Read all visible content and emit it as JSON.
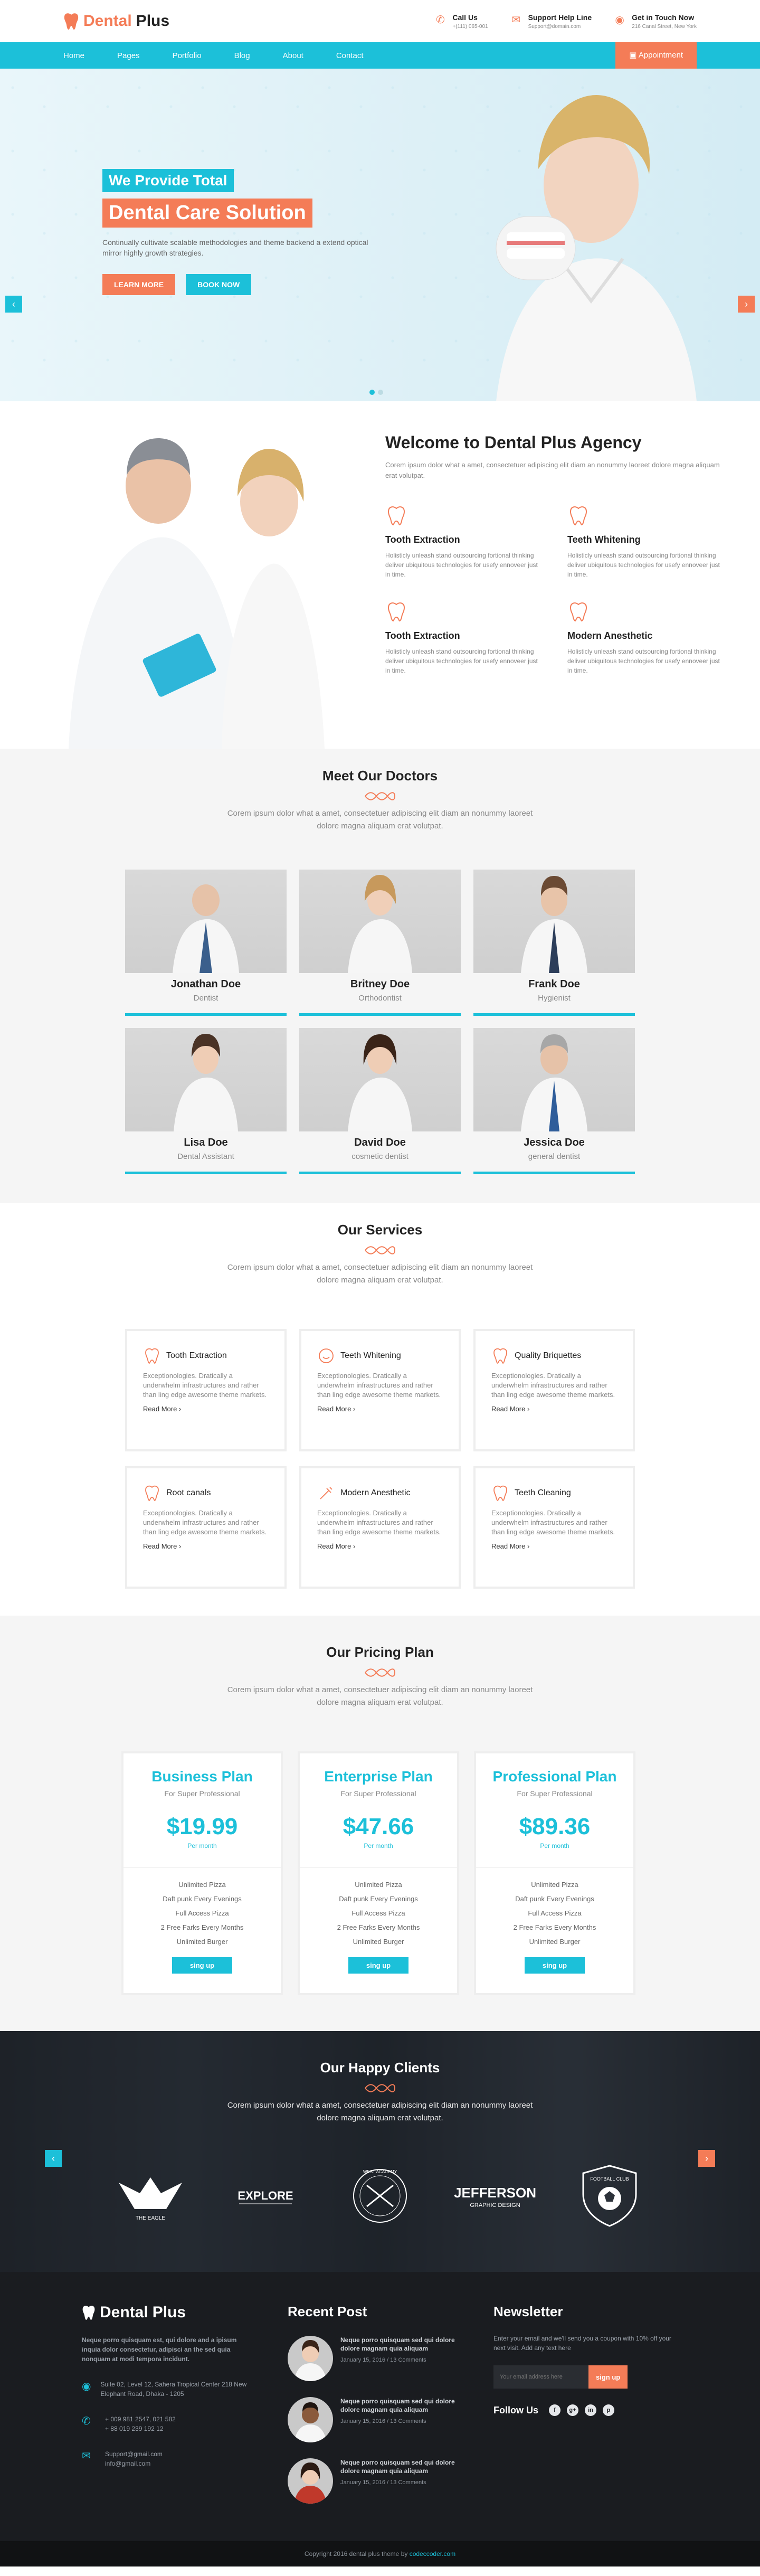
{
  "brand": {
    "name_part1": "Dental",
    "name_part2": "Plus"
  },
  "topbar": {
    "contacts": [
      {
        "icon": "phone-icon",
        "title": "Call Us",
        "sub": "+(111) 065-001"
      },
      {
        "icon": "mail-icon",
        "title": "Support Help Line",
        "sub": "Support@domain.com"
      },
      {
        "icon": "location-icon",
        "title": "Get in Touch Now",
        "sub": "216 Canal Street, New York"
      }
    ]
  },
  "nav": {
    "items": [
      "Home",
      "Pages",
      "Portfolio",
      "Blog",
      "About",
      "Contact"
    ],
    "appointment": "Appointment"
  },
  "hero": {
    "tag1": "We Provide Total",
    "tag2": "Dental Care Solution",
    "desc": "Continually cultivate scalable methodologies and theme backend a extend optical mirror highly growth strategies.",
    "btn_more": "LEARN MORE",
    "btn_book": "BOOK NOW"
  },
  "welcome": {
    "title": "Welcome to Dental Plus Agency",
    "lead": "Corem ipsum dolor what a amet, consectetuer adipiscing elit diam an nonummy laoreet dolore magna aliquam erat volutpat.",
    "features": [
      {
        "title": "Tooth Extraction",
        "desc": "Holisticly unleash stand outsourcing fortional thinking deliver ubiquitous technologies for usefy ennoveer just in time."
      },
      {
        "title": "Teeth Whitening",
        "desc": "Holisticly unleash stand outsourcing fortional thinking deliver ubiquitous technologies for usefy ennoveer just in time."
      },
      {
        "title": "Tooth Extraction",
        "desc": "Holisticly unleash stand outsourcing fortional thinking deliver ubiquitous technologies for usefy ennoveer just in time."
      },
      {
        "title": "Modern Anesthetic",
        "desc": "Holisticly unleash stand outsourcing fortional thinking deliver ubiquitous technologies for usefy ennoveer just in time."
      }
    ]
  },
  "doctors": {
    "title": "Meet Our Doctors",
    "lead": "Corem ipsum dolor what a amet, consectetuer adipiscing elit diam an nonummy laoreet dolore magna aliquam erat volutpat.",
    "list": [
      {
        "name": "Jonathan Doe",
        "role": "Dentist"
      },
      {
        "name": "Britney Doe",
        "role": "Orthodontist"
      },
      {
        "name": "Frank Doe",
        "role": "Hygienist"
      },
      {
        "name": "Lisa Doe",
        "role": "Dental Assistant"
      },
      {
        "name": "David Doe",
        "role": "cosmetic dentist"
      },
      {
        "name": "Jessica Doe",
        "role": "general dentist"
      }
    ]
  },
  "services": {
    "title": "Our Services",
    "lead": "Corem ipsum dolor what a amet, consectetuer adipiscing elit diam an nonummy laoreet dolore magna aliquam erat volutpat.",
    "more": "Read More",
    "list": [
      {
        "title": "Tooth Extraction",
        "desc": "Exceptionologies. Dratically a underwhelm infrastructures and rather than ling edge awesome theme markets."
      },
      {
        "title": "Teeth Whitening",
        "desc": "Exceptionologies. Dratically a underwhelm infrastructures and rather than ling edge awesome theme markets."
      },
      {
        "title": "Quality Briquettes",
        "desc": "Exceptionologies. Dratically a underwhelm infrastructures and rather than ling edge awesome theme markets."
      },
      {
        "title": "Root canals",
        "desc": "Exceptionologies. Dratically a underwhelm infrastructures and rather than ling edge awesome theme markets."
      },
      {
        "title": "Modern Anesthetic",
        "desc": "Exceptionologies. Dratically a underwhelm infrastructures and rather than ling edge awesome theme markets."
      },
      {
        "title": "Teeth Cleaning",
        "desc": "Exceptionologies. Dratically a underwhelm infrastructures and rather than ling edge awesome theme markets."
      }
    ]
  },
  "pricing": {
    "title": "Our Pricing Plan",
    "lead": "Corem ipsum dolor what a amet, consectetuer adipiscing elit diam an nonummy laoreet dolore magna aliquam erat volutpat.",
    "per": "Per month",
    "signup": "sing up",
    "features": [
      "Unlimited Pizza",
      "Daft punk Every Evenings",
      "Full Access Pizza",
      "2 Free Farks Every Months",
      "Unlimited Burger"
    ],
    "plans": [
      {
        "name": "Business Plan",
        "sub": "For Super Professional",
        "price": "$19.99"
      },
      {
        "name": "Enterprise Plan",
        "sub": "For Super Professional",
        "price": "$47.66"
      },
      {
        "name": "Professional Plan",
        "sub": "For Super Professional",
        "price": "$89.36"
      }
    ]
  },
  "clients": {
    "title": "Our Happy Clients",
    "lead": "Corem ipsum dolor what a amet, consectetuer adipiscing elit diam an nonummy laoreet dolore magna aliquam erat volutpat.",
    "logos": [
      "THE EAGLE",
      "EXPLORE",
      "WEST ACADEMY",
      "JEFFERSON",
      "FOOTBALL CLUB"
    ],
    "logo_sub": "GRAPHIC DESIGN"
  },
  "footer": {
    "about": "Neque porro quisquam est, qui dolore and a ipisum inquia dolor consectetur, adipisci an the sed quia nonquam at modi tempora incidunt.",
    "address": "Suite 02, Level 12, Sahera Tropical Center 218 New Elephant Road, Dhaka - 1205",
    "phones": "+ 009 981 2547, 021 582\n+ 88 019 239 192 12",
    "emails": "Support@gmail.com\ninfo@gmail.com",
    "recent_title": "Recent Post",
    "posts": [
      {
        "title": "Neque porro quisquam sed qui dolore dolore magnam quia aliquam",
        "date": "January 15, 2016 / 13 Comments"
      },
      {
        "title": "Neque porro quisquam sed qui dolore dolore magnam quia aliquam",
        "date": "January 15, 2016 / 13 Comments"
      },
      {
        "title": "Neque porro quisquam sed qui dolore dolore magnam quia aliquam",
        "date": "January 15, 2016 / 13 Comments"
      }
    ],
    "newsletter_title": "Newsletter",
    "newsletter_desc": "Enter your email and we'll send you a coupon with 10% off your next visit. Add any text here",
    "email_placeholder": "Your email address here",
    "signup": "sign up",
    "follow": "Follow Us",
    "socials": [
      "f",
      "g+",
      "in",
      "p"
    ]
  },
  "copyright": {
    "text": "Copyright 2016 dental plus theme by ",
    "brand": "codeccoder.com"
  },
  "colors": {
    "accent": "#1cc0d9",
    "brand": "#f47c57",
    "footer": "#1a1c20"
  }
}
